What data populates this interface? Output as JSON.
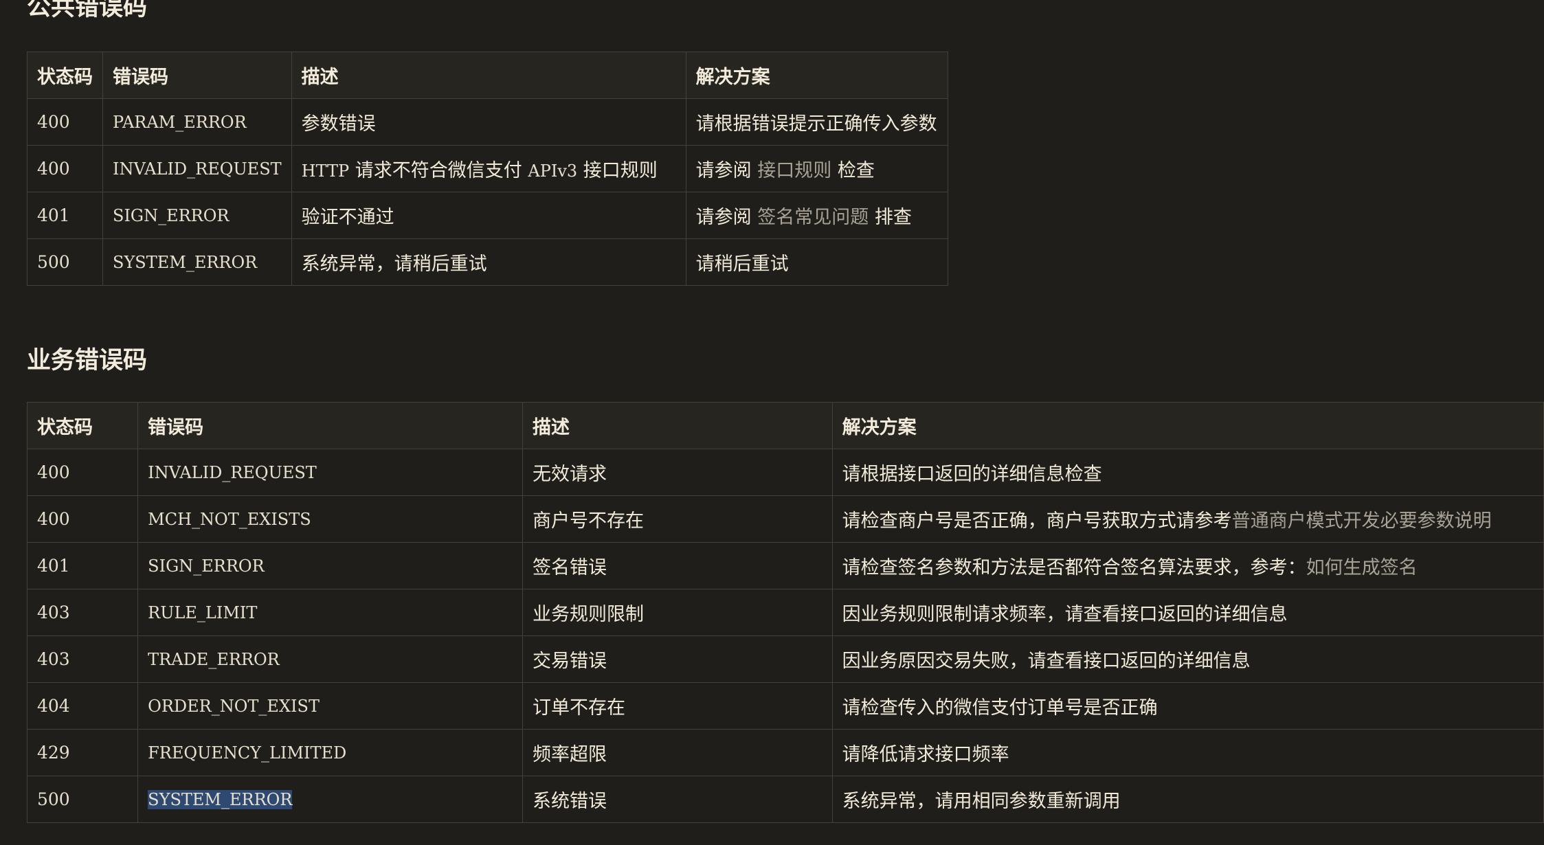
{
  "public_section": {
    "title": "公共错误码",
    "headers": [
      "状态码",
      "错误码",
      "描述",
      "解决方案"
    ],
    "rows": [
      {
        "status": "400",
        "code": "PARAM_ERROR",
        "desc_parts": [
          {
            "text": "参数错误",
            "style": "text"
          }
        ],
        "solution_parts": [
          {
            "text": "请根据错误提示正确传入参数",
            "style": "text"
          }
        ]
      },
      {
        "status": "400",
        "code": "INVALID_REQUEST",
        "desc_parts": [
          {
            "text": "HTTP",
            "style": "mono"
          },
          {
            "text": " 请求不符合微信支付 ",
            "style": "text"
          },
          {
            "text": "APIv3",
            "style": "mono"
          },
          {
            "text": " 接口规则",
            "style": "text"
          }
        ],
        "solution_parts": [
          {
            "text": "请参阅 ",
            "style": "text"
          },
          {
            "text": "接口规则",
            "style": "link"
          },
          {
            "text": " 检查",
            "style": "text"
          }
        ]
      },
      {
        "status": "401",
        "code": "SIGN_ERROR",
        "desc_parts": [
          {
            "text": "验证不通过",
            "style": "text"
          }
        ],
        "solution_parts": [
          {
            "text": "请参阅 ",
            "style": "text"
          },
          {
            "text": "签名常见问题",
            "style": "link"
          },
          {
            "text": " 排查",
            "style": "text"
          }
        ]
      },
      {
        "status": "500",
        "code": "SYSTEM_ERROR",
        "desc_parts": [
          {
            "text": "系统异常，请稍后重试",
            "style": "text"
          }
        ],
        "solution_parts": [
          {
            "text": "请稍后重试",
            "style": "text"
          }
        ]
      }
    ]
  },
  "business_section": {
    "title": "业务错误码",
    "headers": [
      "状态码",
      "错误码",
      "描述",
      "解决方案"
    ],
    "rows": [
      {
        "status": "400",
        "code": "INVALID_REQUEST",
        "desc_parts": [
          {
            "text": "无效请求",
            "style": "text"
          }
        ],
        "solution_parts": [
          {
            "text": "请根据接口返回的详细信息检查",
            "style": "text"
          }
        ]
      },
      {
        "status": "400",
        "code": "MCH_NOT_EXISTS",
        "desc_parts": [
          {
            "text": "商户号不存在",
            "style": "text"
          }
        ],
        "solution_parts": [
          {
            "text": "请检查商户号是否正确，商户号获取方式请参考",
            "style": "text"
          },
          {
            "text": "普通商户模式开发必要参数说明",
            "style": "link"
          }
        ]
      },
      {
        "status": "401",
        "code": "SIGN_ERROR",
        "desc_parts": [
          {
            "text": "签名错误",
            "style": "text"
          }
        ],
        "solution_parts": [
          {
            "text": "请检查签名参数和方法是否都符合签名算法要求，参考：",
            "style": "text"
          },
          {
            "text": "如何生成签名",
            "style": "link"
          }
        ]
      },
      {
        "status": "403",
        "code": "RULE_LIMIT",
        "desc_parts": [
          {
            "text": "业务规则限制",
            "style": "text"
          }
        ],
        "solution_parts": [
          {
            "text": "因业务规则限制请求频率，请查看接口返回的详细信息",
            "style": "text"
          }
        ]
      },
      {
        "status": "403",
        "code": "TRADE_ERROR",
        "desc_parts": [
          {
            "text": "交易错误",
            "style": "text"
          }
        ],
        "solution_parts": [
          {
            "text": "因业务原因交易失败，请查看接口返回的详细信息",
            "style": "text"
          }
        ]
      },
      {
        "status": "404",
        "code": "ORDER_NOT_EXIST",
        "desc_parts": [
          {
            "text": "订单不存在",
            "style": "text"
          }
        ],
        "solution_parts": [
          {
            "text": "请检查传入的微信支付订单号是否正确",
            "style": "text"
          }
        ]
      },
      {
        "status": "429",
        "code": "FREQUENCY_LIMITED",
        "desc_parts": [
          {
            "text": "频率超限",
            "style": "text"
          }
        ],
        "solution_parts": [
          {
            "text": "请降低请求接口频率",
            "style": "text"
          }
        ]
      },
      {
        "status": "500",
        "code": "SYSTEM_ERROR",
        "code_selected": true,
        "desc_parts": [
          {
            "text": "系统错误",
            "style": "text"
          }
        ],
        "solution_parts": [
          {
            "text": "系统异常，请用相同参数重新调用",
            "style": "text"
          }
        ]
      }
    ]
  }
}
